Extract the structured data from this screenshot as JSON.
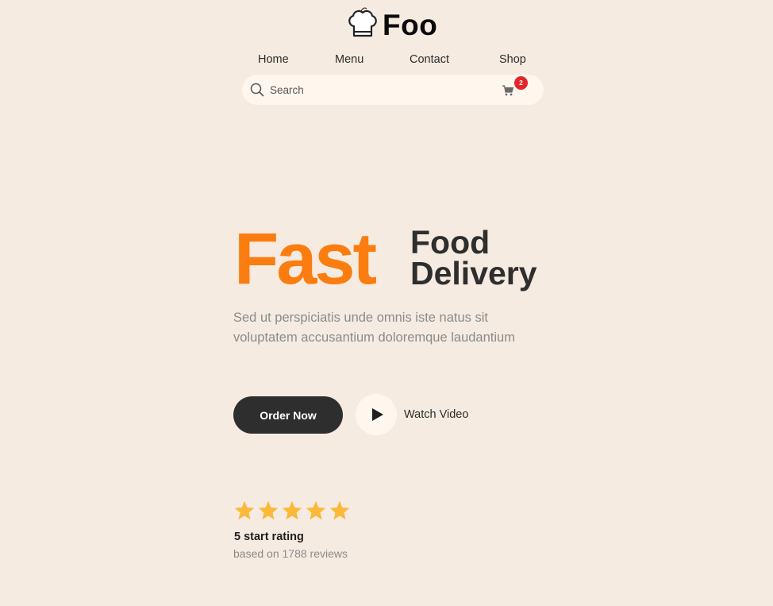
{
  "brand": {
    "name": "Foo",
    "logo_icon": "chef-hat-icon"
  },
  "nav": {
    "items": [
      {
        "label": "Home"
      },
      {
        "label": "Menu"
      },
      {
        "label": "Contact"
      },
      {
        "label": "Shop"
      }
    ]
  },
  "search": {
    "placeholder": "Search",
    "value": "",
    "icon": "search-icon"
  },
  "cart": {
    "icon": "shopping-cart-icon",
    "count": "2"
  },
  "hero": {
    "title_highlight": "Fast",
    "title_line1": "Food",
    "title_line2": "Delivery",
    "description": "Sed ut perspiciatis unde omnis iste natus sit voluptatem accusantium doloremque laudantium",
    "order_button_label": "Order Now",
    "watch_video_label": "Watch Video",
    "play_icon": "play-icon"
  },
  "rating": {
    "stars": 5,
    "max_stars": 5,
    "star_icon": "star-icon",
    "title": "5 start rating",
    "subtitle": "based on 1788 reviews"
  },
  "colors": {
    "background": "#f5ebe0",
    "accent_orange": "#fb7d0f",
    "dark": "#2e2e2e",
    "star_yellow": "#fbb93b",
    "badge_red": "#e3242b",
    "muted_text": "#8b8b8b",
    "light_surface": "#fff7ee"
  }
}
